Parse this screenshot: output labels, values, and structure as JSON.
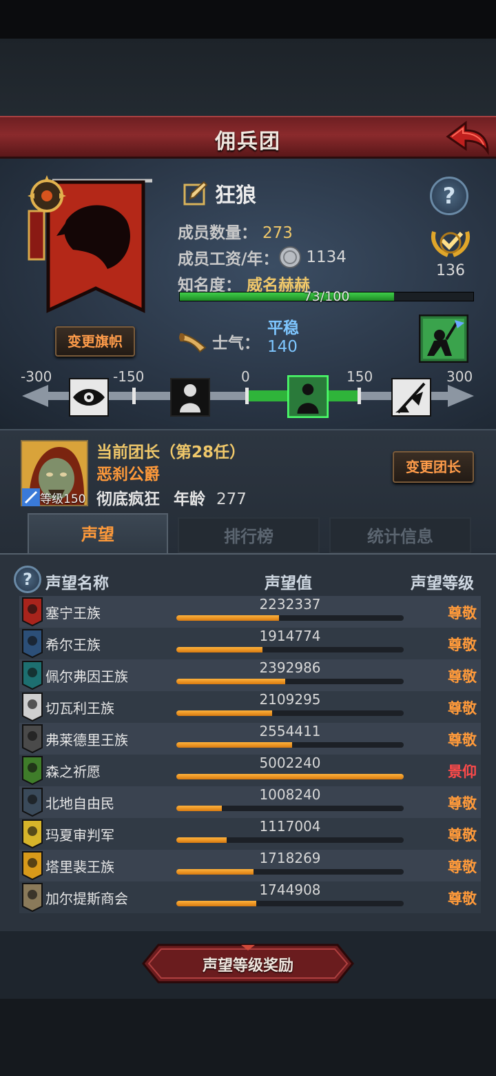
{
  "header": {
    "title": "佣兵团"
  },
  "company": {
    "name": "狂狼",
    "members_label": "成员数量：",
    "members": "273",
    "wage_label": "成员工资/年：",
    "wage": "1134",
    "fame_label": "知名度：",
    "fame_title": "威名赫赫",
    "fame_progress_text": "73/100",
    "fame_fraction": 0.73,
    "rank_badge_value": "136",
    "change_flag_label": "变更旗帜",
    "banner_color": "#b42818"
  },
  "morale": {
    "label": "士气：",
    "state": "平稳",
    "value": "140",
    "scale_labels": [
      "-300",
      "-150",
      "0",
      "150",
      "300"
    ]
  },
  "commander": {
    "title": "当前团长（第28任）",
    "name": "恶刹公爵",
    "trait": "彻底疯狂",
    "age_label": "年龄",
    "age": "277",
    "level_text": "等级150",
    "change_label": "变更团长"
  },
  "tabs": [
    {
      "label": "声望",
      "active": true
    },
    {
      "label": "排行榜",
      "active": false
    },
    {
      "label": "统计信息",
      "active": false
    }
  ],
  "reputation": {
    "headers": {
      "name": "声望名称",
      "value": "声望值",
      "level": "声望等级"
    },
    "rows": [
      {
        "name": "塞宁王族",
        "value": "2232337",
        "fraction": 0.45,
        "level": "尊敬",
        "emblem_color": "#a8241c"
      },
      {
        "name": "希尔王族",
        "value": "1914774",
        "fraction": 0.38,
        "level": "尊敬",
        "emblem_color": "#2c4f78"
      },
      {
        "name": "佩尔弗因王族",
        "value": "2392986",
        "fraction": 0.48,
        "level": "尊敬",
        "emblem_color": "#1d6f70"
      },
      {
        "name": "切瓦利王族",
        "value": "2109295",
        "fraction": 0.42,
        "level": "尊敬",
        "emblem_color": "#cfcfcf"
      },
      {
        "name": "弗莱德里王族",
        "value": "2554411",
        "fraction": 0.51,
        "level": "尊敬",
        "emblem_color": "#4a4a4a"
      },
      {
        "name": "森之祈愿",
        "value": "5002240",
        "fraction": 1.0,
        "level": "景仰",
        "emblem_color": "#3f7d2a"
      },
      {
        "name": "北地自由民",
        "value": "1008240",
        "fraction": 0.2,
        "level": "尊敬",
        "emblem_color": "#3a4a5a"
      },
      {
        "name": "玛夏审判军",
        "value": "1117004",
        "fraction": 0.22,
        "level": "尊敬",
        "emblem_color": "#d6b42a"
      },
      {
        "name": "塔里裴王族",
        "value": "1718269",
        "fraction": 0.34,
        "level": "尊敬",
        "emblem_color": "#d89a1a"
      },
      {
        "name": "加尔提斯商会",
        "value": "1744908",
        "fraction": 0.35,
        "level": "尊敬",
        "emblem_color": "#8a7a5a"
      }
    ]
  },
  "reward_button": "声望等级奖励"
}
